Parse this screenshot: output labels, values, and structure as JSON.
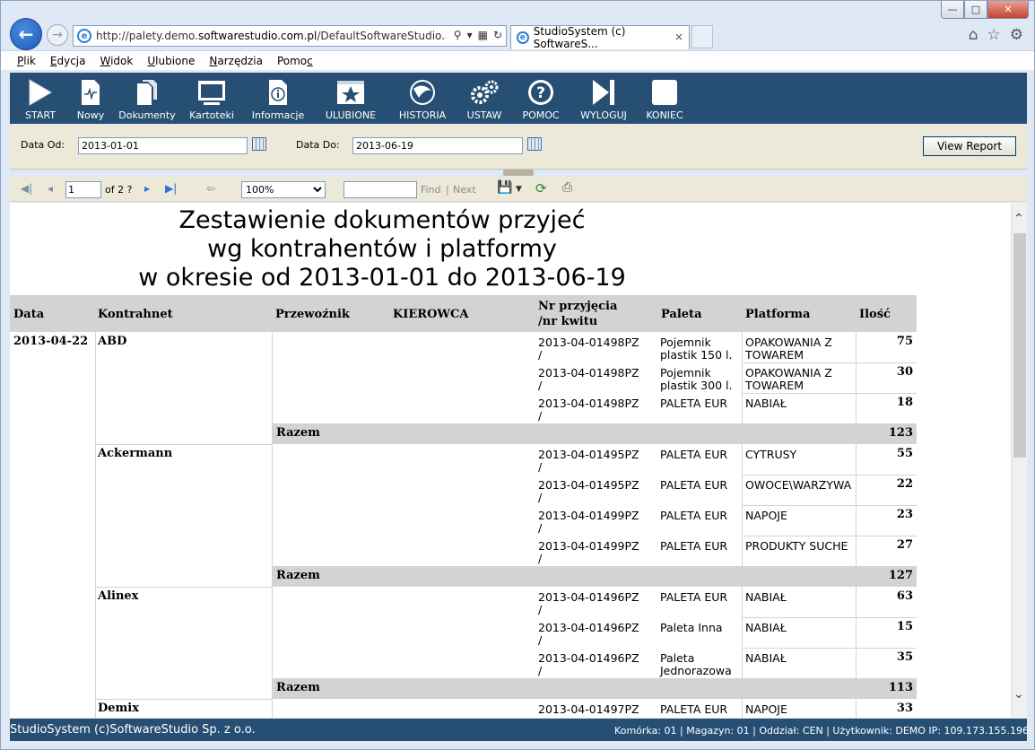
{
  "browser": {
    "url_prefix": "http://palety.demo.",
    "url_domain": "softwarestudio.com.pl",
    "url_suffix": "/DefaultSoftwareStudio.aspx?rol",
    "tab_title": "StudioSystem (c) SoftwareS...",
    "tab_close": "×",
    "window_min": "—",
    "window_max": "□",
    "window_close": "✕"
  },
  "menu": [
    {
      "ul": "P",
      "rest": "lik"
    },
    {
      "ul": "E",
      "rest": "dycja"
    },
    {
      "ul": "W",
      "rest": "idok"
    },
    {
      "ul": "U",
      "rest": "lubione"
    },
    {
      "ul": "N",
      "rest": "arzędzia"
    },
    {
      "ul": "Pomo",
      "rest": "c"
    }
  ],
  "toolbar": [
    {
      "label": "START",
      "icon": "play-icon"
    },
    {
      "label": "Nowy",
      "icon": "new-document-icon"
    },
    {
      "label": "Dokumenty",
      "icon": "documents-icon"
    },
    {
      "label": "Kartoteki",
      "icon": "monitor-icon"
    },
    {
      "label": "Informacje",
      "icon": "info-icon"
    },
    {
      "label": "ULUBIONE",
      "icon": "star-icon"
    },
    {
      "label": "HISTORIA",
      "icon": "history-icon"
    },
    {
      "label": "USTAW",
      "icon": "gears-icon"
    },
    {
      "label": "POMOC",
      "icon": "help-icon"
    },
    {
      "label": "WYLOGUJ",
      "icon": "logout-icon"
    },
    {
      "label": "KONIEC",
      "icon": "stop-icon"
    }
  ],
  "params": {
    "date_from_label": "Data Od:",
    "date_from_value": "2013-01-01",
    "date_to_label": "Data Do:",
    "date_to_value": "2013-06-19",
    "view_report": "View Report"
  },
  "report_toolbar": {
    "page_value": "1",
    "page_of": "of 2 ?",
    "zoom": "100%",
    "find": "Find",
    "separator": "|",
    "next": "Next"
  },
  "report": {
    "title_lines": [
      "Zestawienie dokumentów przyjeć",
      "wg kontrahentów i platformy",
      "w okresie od 2013-01-01 do 2013-06-19"
    ],
    "headers": {
      "data": "Data",
      "kontrahent": "Kontrahnet",
      "przewoznik": "Przewoźnik",
      "kierowca": "KIEROWCA",
      "nr1": "Nr przyjęcia",
      "nr2": "/nr kwitu",
      "paleta": "Paleta",
      "platforma": "Platforma",
      "ilosc": "Ilość"
    },
    "date": "2013-04-22",
    "sum_label": "Razem",
    "groups": [
      {
        "name": "ABD",
        "rows": [
          {
            "nr": "2013-04-01498PZ",
            "nr2": "/",
            "paleta1": "Pojemnik",
            "paleta2": "plastik 150 l.",
            "platforma1": "OPAKOWANIA Z",
            "platforma2": "TOWAREM",
            "ilosc": "75"
          },
          {
            "nr": "2013-04-01498PZ",
            "nr2": "/",
            "paleta1": "Pojemnik",
            "paleta2": "plastik 300 l.",
            "platforma1": "OPAKOWANIA Z",
            "platforma2": "TOWAREM",
            "ilosc": "30"
          },
          {
            "nr": "2013-04-01498PZ",
            "nr2": "/",
            "paleta1": "PALETA EUR",
            "paleta2": "",
            "platforma1": "NABIAŁ",
            "platforma2": "",
            "ilosc": "18"
          }
        ],
        "total": "123"
      },
      {
        "name": "Ackermann",
        "rows": [
          {
            "nr": "2013-04-01495PZ",
            "nr2": "/",
            "paleta1": "PALETA EUR",
            "paleta2": "",
            "platforma1": "CYTRUSY",
            "platforma2": "",
            "ilosc": "55"
          },
          {
            "nr": "2013-04-01495PZ",
            "nr2": "/",
            "paleta1": "PALETA EUR",
            "paleta2": "",
            "platforma1": "OWOCE\\WARZYWA",
            "platforma2": "",
            "ilosc": "22"
          },
          {
            "nr": "2013-04-01499PZ",
            "nr2": "/",
            "paleta1": "PALETA EUR",
            "paleta2": "",
            "platforma1": "NAPOJE",
            "platforma2": "",
            "ilosc": "23"
          },
          {
            "nr": "2013-04-01499PZ",
            "nr2": "/",
            "paleta1": "PALETA EUR",
            "paleta2": "",
            "platforma1": "PRODUKTY SUCHE",
            "platforma2": "",
            "ilosc": "27"
          }
        ],
        "total": "127"
      },
      {
        "name": "Alinex",
        "rows": [
          {
            "nr": "2013-04-01496PZ",
            "nr2": "/",
            "paleta1": "PALETA EUR",
            "paleta2": "",
            "platforma1": "NABIAŁ",
            "platforma2": "",
            "ilosc": "63"
          },
          {
            "nr": "2013-04-01496PZ",
            "nr2": "/",
            "paleta1": "Paleta Inna",
            "paleta2": "",
            "platforma1": "NABIAŁ",
            "platforma2": "",
            "ilosc": "15"
          },
          {
            "nr": "2013-04-01496PZ",
            "nr2": "/",
            "paleta1": "Paleta",
            "paleta2": "Jednorazowa",
            "platforma1": "NABIAŁ",
            "platforma2": "",
            "ilosc": "35"
          }
        ],
        "total": "113"
      },
      {
        "name": "Demix",
        "rows": [
          {
            "nr": "2013-04-01497PZ",
            "nr2": "",
            "paleta1": "PALETA EUR",
            "paleta2": "",
            "platforma1": "NAPOJE",
            "platforma2": "",
            "ilosc": "33"
          }
        ],
        "total": ""
      }
    ]
  },
  "status": {
    "left": "StudioSystem (c)SoftwareStudio Sp. z o.o.",
    "right": "Komórka: 01 | Magazyn: 01 | Oddział: CEN | Użytkownik: DEMO IP: 109.173.155.196"
  },
  "colors": {
    "toolbar_bg": "#274f74",
    "header_gray": "#d3d3d3",
    "params_bg": "#ece9d8"
  }
}
